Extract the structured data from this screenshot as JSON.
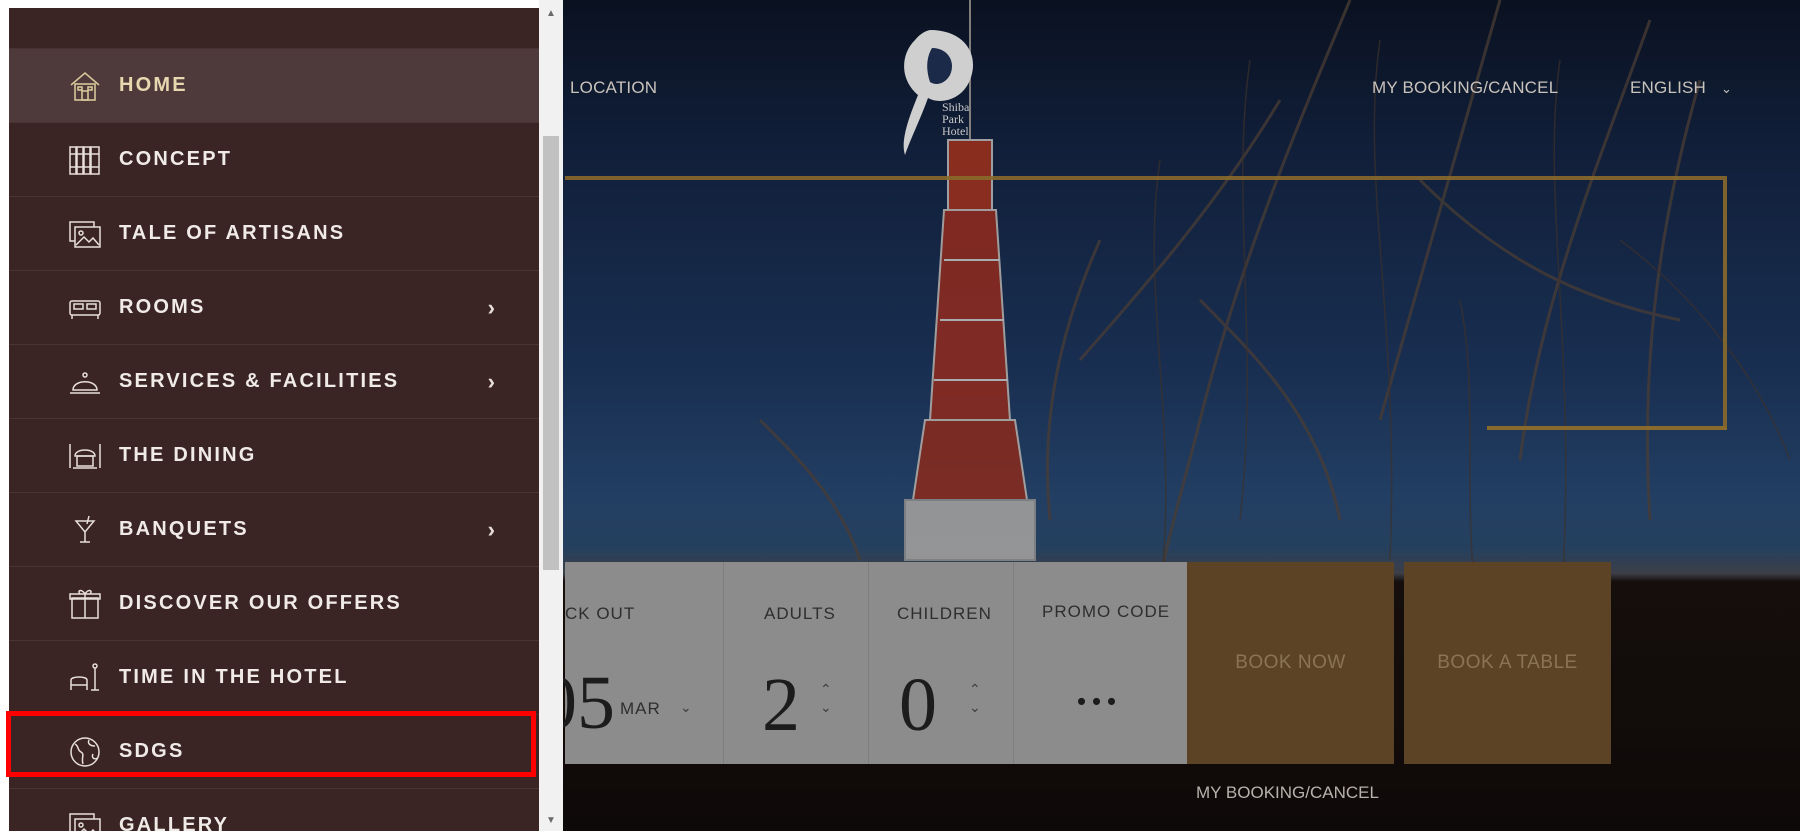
{
  "topnav": {
    "location": "LOCATION",
    "my_booking": "MY BOOKING/CANCEL",
    "language": "ENGLISH",
    "logo_text": [
      "Shiba",
      "Park",
      "Hotel"
    ]
  },
  "sidebar": {
    "items": [
      {
        "label": "HOME",
        "icon": "house-icon",
        "has_submenu": false,
        "active": true
      },
      {
        "label": "CONCEPT",
        "icon": "books-icon",
        "has_submenu": false
      },
      {
        "label": "TALE OF ARTISANS",
        "icon": "gallery-icon",
        "has_submenu": false
      },
      {
        "label": "ROOMS",
        "icon": "bed-icon",
        "has_submenu": true
      },
      {
        "label": "SERVICES & FACILITIES",
        "icon": "service-bell-icon",
        "has_submenu": true
      },
      {
        "label": "THE DINING",
        "icon": "dining-icon",
        "has_submenu": false
      },
      {
        "label": "BANQUETS",
        "icon": "cocktail-icon",
        "has_submenu": true
      },
      {
        "label": "DISCOVER OUR OFFERS",
        "icon": "gift-icon",
        "has_submenu": false
      },
      {
        "label": "TIME IN THE HOTEL",
        "icon": "lounge-icon",
        "has_submenu": false
      },
      {
        "label": "SDGS",
        "icon": "globe-icon",
        "has_submenu": false,
        "highlighted": true
      },
      {
        "label": "GALLERY",
        "icon": "gallery-icon",
        "has_submenu": false
      }
    ]
  },
  "booking": {
    "checkout_label": "CK OUT",
    "checkout_day": "05",
    "checkout_month": "MAR",
    "adults_label": "ADULTS",
    "adults_value": "2",
    "children_label": "CHILDREN",
    "children_value": "0",
    "promo_label": "PROMO CODE",
    "promo_value": "...",
    "book_now": "BOOK NOW",
    "book_table": "BOOK A TABLE",
    "my_booking_link": "MY BOOKING/CANCEL"
  },
  "colors": {
    "sidebar_bg": "#3a2424",
    "active_item_bg": "#4e3a3a",
    "gold_button": "#5c4326",
    "highlight": "#ff0000"
  }
}
